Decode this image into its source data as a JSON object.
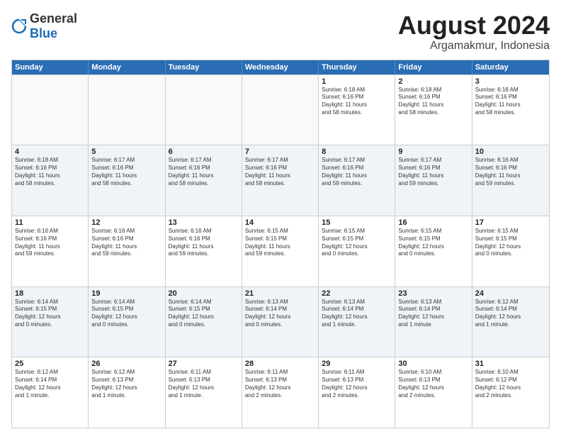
{
  "logo": {
    "general": "General",
    "blue": "Blue"
  },
  "title": {
    "month_year": "August 2024",
    "location": "Argamakmur, Indonesia"
  },
  "header_days": [
    "Sunday",
    "Monday",
    "Tuesday",
    "Wednesday",
    "Thursday",
    "Friday",
    "Saturday"
  ],
  "weeks": [
    [
      {
        "day": "",
        "info": ""
      },
      {
        "day": "",
        "info": ""
      },
      {
        "day": "",
        "info": ""
      },
      {
        "day": "",
        "info": ""
      },
      {
        "day": "1",
        "info": "Sunrise: 6:18 AM\nSunset: 6:16 PM\nDaylight: 11 hours\nand 58 minutes."
      },
      {
        "day": "2",
        "info": "Sunrise: 6:18 AM\nSunset: 6:16 PM\nDaylight: 11 hours\nand 58 minutes."
      },
      {
        "day": "3",
        "info": "Sunrise: 6:18 AM\nSunset: 6:16 PM\nDaylight: 11 hours\nand 58 minutes."
      }
    ],
    [
      {
        "day": "4",
        "info": "Sunrise: 6:18 AM\nSunset: 6:16 PM\nDaylight: 11 hours\nand 58 minutes."
      },
      {
        "day": "5",
        "info": "Sunrise: 6:17 AM\nSunset: 6:16 PM\nDaylight: 11 hours\nand 58 minutes."
      },
      {
        "day": "6",
        "info": "Sunrise: 6:17 AM\nSunset: 6:16 PM\nDaylight: 11 hours\nand 58 minutes."
      },
      {
        "day": "7",
        "info": "Sunrise: 6:17 AM\nSunset: 6:16 PM\nDaylight: 11 hours\nand 58 minutes."
      },
      {
        "day": "8",
        "info": "Sunrise: 6:17 AM\nSunset: 6:16 PM\nDaylight: 11 hours\nand 59 minutes."
      },
      {
        "day": "9",
        "info": "Sunrise: 6:17 AM\nSunset: 6:16 PM\nDaylight: 11 hours\nand 59 minutes."
      },
      {
        "day": "10",
        "info": "Sunrise: 6:16 AM\nSunset: 6:16 PM\nDaylight: 11 hours\nand 59 minutes."
      }
    ],
    [
      {
        "day": "11",
        "info": "Sunrise: 6:16 AM\nSunset: 6:16 PM\nDaylight: 11 hours\nand 59 minutes."
      },
      {
        "day": "12",
        "info": "Sunrise: 6:16 AM\nSunset: 6:16 PM\nDaylight: 11 hours\nand 59 minutes."
      },
      {
        "day": "13",
        "info": "Sunrise: 6:16 AM\nSunset: 6:16 PM\nDaylight: 11 hours\nand 59 minutes."
      },
      {
        "day": "14",
        "info": "Sunrise: 6:15 AM\nSunset: 6:15 PM\nDaylight: 11 hours\nand 59 minutes."
      },
      {
        "day": "15",
        "info": "Sunrise: 6:15 AM\nSunset: 6:15 PM\nDaylight: 12 hours\nand 0 minutes."
      },
      {
        "day": "16",
        "info": "Sunrise: 6:15 AM\nSunset: 6:15 PM\nDaylight: 12 hours\nand 0 minutes."
      },
      {
        "day": "17",
        "info": "Sunrise: 6:15 AM\nSunset: 6:15 PM\nDaylight: 12 hours\nand 0 minutes."
      }
    ],
    [
      {
        "day": "18",
        "info": "Sunrise: 6:14 AM\nSunset: 6:15 PM\nDaylight: 12 hours\nand 0 minutes."
      },
      {
        "day": "19",
        "info": "Sunrise: 6:14 AM\nSunset: 6:15 PM\nDaylight: 12 hours\nand 0 minutes."
      },
      {
        "day": "20",
        "info": "Sunrise: 6:14 AM\nSunset: 6:15 PM\nDaylight: 12 hours\nand 0 minutes."
      },
      {
        "day": "21",
        "info": "Sunrise: 6:13 AM\nSunset: 6:14 PM\nDaylight: 12 hours\nand 0 minutes."
      },
      {
        "day": "22",
        "info": "Sunrise: 6:13 AM\nSunset: 6:14 PM\nDaylight: 12 hours\nand 1 minute."
      },
      {
        "day": "23",
        "info": "Sunrise: 6:13 AM\nSunset: 6:14 PM\nDaylight: 12 hours\nand 1 minute."
      },
      {
        "day": "24",
        "info": "Sunrise: 6:12 AM\nSunset: 6:14 PM\nDaylight: 12 hours\nand 1 minute."
      }
    ],
    [
      {
        "day": "25",
        "info": "Sunrise: 6:12 AM\nSunset: 6:14 PM\nDaylight: 12 hours\nand 1 minute."
      },
      {
        "day": "26",
        "info": "Sunrise: 6:12 AM\nSunset: 6:13 PM\nDaylight: 12 hours\nand 1 minute."
      },
      {
        "day": "27",
        "info": "Sunrise: 6:11 AM\nSunset: 6:13 PM\nDaylight: 12 hours\nand 1 minute."
      },
      {
        "day": "28",
        "info": "Sunrise: 6:11 AM\nSunset: 6:13 PM\nDaylight: 12 hours\nand 2 minutes."
      },
      {
        "day": "29",
        "info": "Sunrise: 6:11 AM\nSunset: 6:13 PM\nDaylight: 12 hours\nand 2 minutes."
      },
      {
        "day": "30",
        "info": "Sunrise: 6:10 AM\nSunset: 6:13 PM\nDaylight: 12 hours\nand 2 minutes."
      },
      {
        "day": "31",
        "info": "Sunrise: 6:10 AM\nSunset: 6:12 PM\nDaylight: 12 hours\nand 2 minutes."
      }
    ]
  ]
}
